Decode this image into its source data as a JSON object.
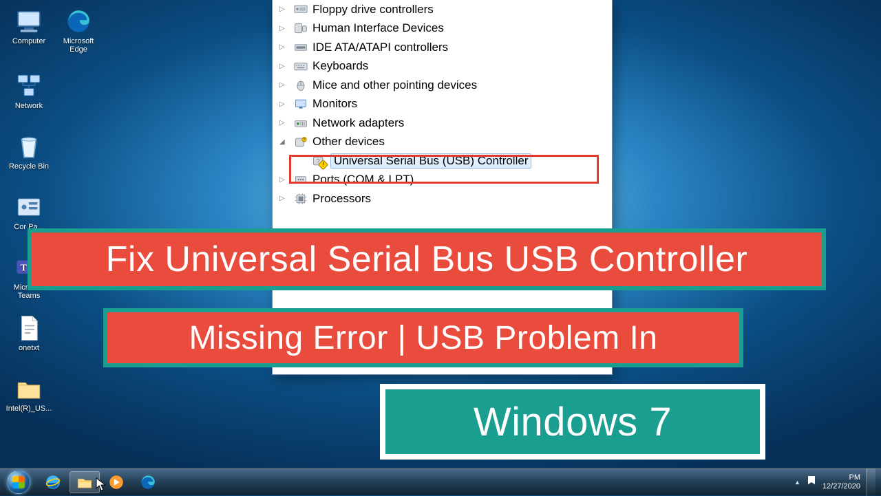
{
  "desktop_icons": [
    {
      "id": "computer",
      "label": "Computer"
    },
    {
      "id": "edge",
      "label": "Microsoft Edge"
    },
    {
      "id": "network",
      "label": "Network"
    },
    {
      "id": "recycle",
      "label": "Recycle Bin"
    },
    {
      "id": "controlpanel",
      "label": "Cor Pa..."
    },
    {
      "id": "teams",
      "label": "Microsoft Teams"
    },
    {
      "id": "onetxt",
      "label": "onetxt"
    },
    {
      "id": "intelusb",
      "label": "Intel(R)_US..."
    }
  ],
  "devmgr": {
    "nodes": [
      {
        "label": "Floppy drive controllers",
        "icon": "floppy"
      },
      {
        "label": "Human Interface Devices",
        "icon": "hid"
      },
      {
        "label": "IDE ATA/ATAPI controllers",
        "icon": "ide"
      },
      {
        "label": "Keyboards",
        "icon": "keyboard"
      },
      {
        "label": "Mice and other pointing devices",
        "icon": "mouse"
      },
      {
        "label": "Monitors",
        "icon": "monitor"
      },
      {
        "label": "Network adapters",
        "icon": "net"
      },
      {
        "label": "Other devices",
        "icon": "other",
        "expanded": true
      },
      {
        "label": "Ports (COM & LPT)",
        "icon": "port"
      },
      {
        "label": "Processors",
        "icon": "cpu"
      }
    ],
    "problem_device": "Universal Serial Bus (USB) Controller"
  },
  "banners": {
    "line1": "Fix Universal Serial Bus USB Controller",
    "line2": "Missing Error | USB Problem In",
    "line3": "Windows 7"
  },
  "taskbar": {
    "pinned": [
      "ie",
      "explorer",
      "wmp",
      "edge"
    ],
    "time": "PM",
    "date": "12/27/2020"
  }
}
